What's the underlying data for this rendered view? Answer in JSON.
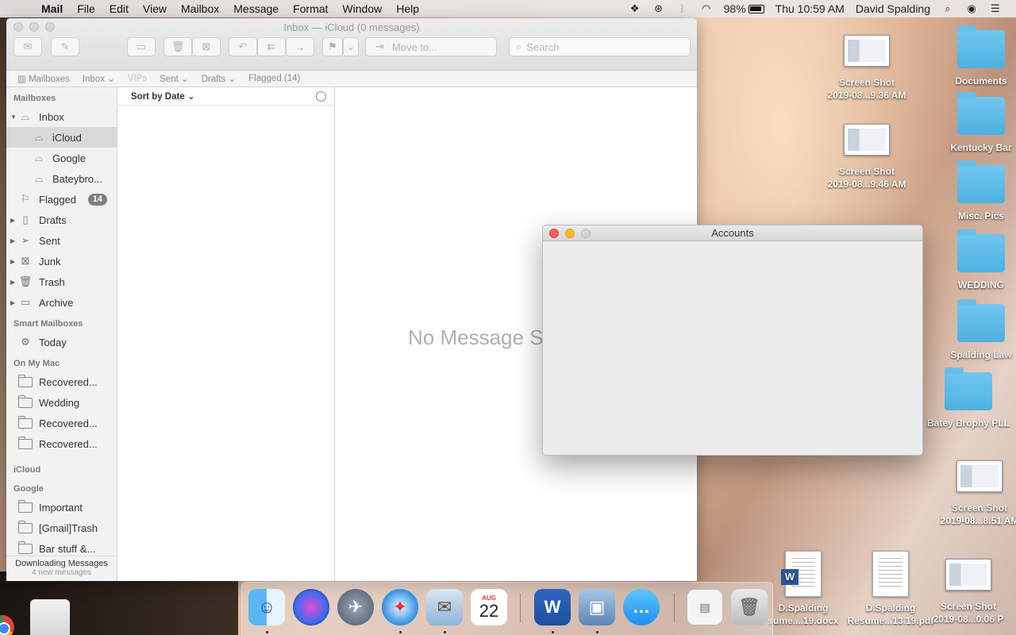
{
  "menubar": {
    "app": "Mail",
    "items": [
      "File",
      "Edit",
      "View",
      "Mailbox",
      "Message",
      "Format",
      "Window",
      "Help"
    ],
    "battery_pct": "98%",
    "battery_level": 0.98,
    "clock": "Thu 10:59 AM",
    "user": "David Spalding"
  },
  "mail": {
    "title": "Inbox — iCloud (0 messages)",
    "search_placeholder": "Search",
    "move_to": "Move to...",
    "favorites": [
      "Mailboxes",
      "Inbox",
      "VIPs",
      "Sent",
      "Drafts",
      "Flagged (14)"
    ],
    "sidebar": {
      "mailboxes_header": "Mailboxes",
      "inbox": "Inbox",
      "inbox_children": [
        "iCloud",
        "Google",
        "Bateybro..."
      ],
      "flagged": "Flagged",
      "flagged_count": "14",
      "folders": [
        "Drafts",
        "Sent",
        "Junk",
        "Trash",
        "Archive"
      ],
      "smart_header": "Smart Mailboxes",
      "today": "Today",
      "onmymac_header": "On My Mac",
      "onmymac": [
        "Recovered...",
        "Wedding",
        "Recovered...",
        "Recovered..."
      ],
      "icloud_header": "iCloud",
      "google_header": "Google",
      "google": [
        "Important",
        "[Gmail]Trash",
        "Bar stuff &..."
      ],
      "status": "Downloading Messages",
      "status_sub": "4 new messages"
    },
    "sort_label": "Sort by Date",
    "no_message": "No Message Selected"
  },
  "accounts": {
    "title": "Accounts"
  },
  "desktop": {
    "icons": {
      "shot1": [
        "Screen Shot",
        "2019-08...9.36 AM"
      ],
      "shot2": [
        "Screen Shot",
        "2019-08...9.46 AM"
      ],
      "documents": "Documents",
      "kentucky": "Kentucky Bar",
      "misc": "Misc. Pics",
      "wedding": "WEDDING",
      "spalding": "Spalding Law",
      "batey": "Batey Brophy PLL",
      "shot3": [
        "Screen Shot",
        "2019-08...8.51 AM"
      ],
      "shot4": [
        "Screen Shot",
        "2019-08...0.06 P"
      ],
      "resume_docx": [
        "D.Spalding",
        "sume....19.docx"
      ],
      "resume_pdf": [
        "D.Spalding",
        "Resume...13.19.pdf"
      ]
    }
  },
  "dock": {
    "calendar_month": "AUG",
    "calendar_day": "22"
  }
}
